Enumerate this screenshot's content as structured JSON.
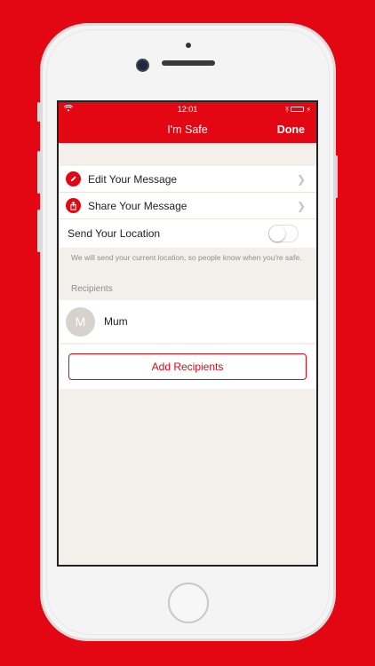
{
  "status_bar": {
    "time": "12:01"
  },
  "nav": {
    "title": "I'm Safe",
    "done_label": "Done"
  },
  "menu": {
    "edit_label": "Edit Your Message",
    "share_label": "Share Your Message",
    "location_label": "Send Your Location",
    "location_enabled": false
  },
  "location_note": "We will send your current location, so people know when you're safe.",
  "recipients": {
    "header": "Recipients",
    "items": [
      {
        "initial": "M",
        "name": "Mum"
      }
    ],
    "add_label": "Add Recipients"
  },
  "colors": {
    "accent": "#e30613",
    "background": "#f3efeb"
  },
  "icons": {
    "edit": "pencil-icon",
    "share": "share-icon",
    "chevron": "chevron-right-icon",
    "wifi": "wifi-icon",
    "bluetooth": "bluetooth-icon",
    "battery": "battery-icon",
    "charging": "bolt-icon"
  }
}
